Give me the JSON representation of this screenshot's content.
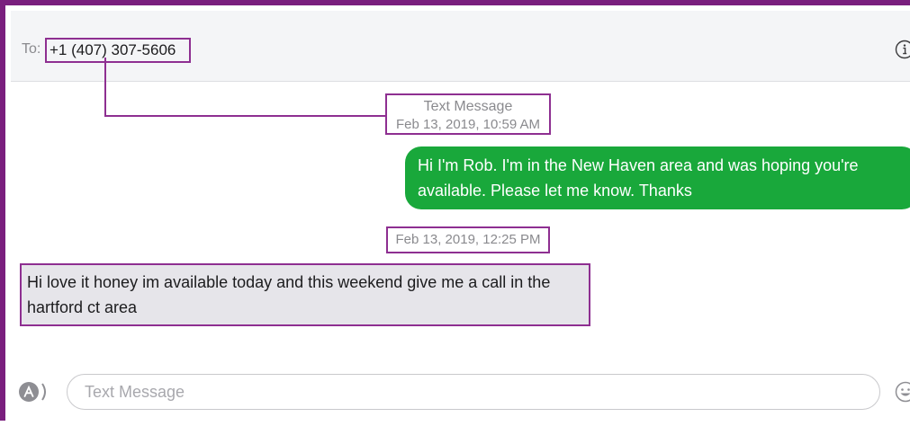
{
  "header": {
    "to_label": "To:",
    "recipient": "+1 (407) 307-5606",
    "info_icon": "info-circle-icon"
  },
  "conversation": {
    "first_timestamp": {
      "service": "Text Message",
      "time": "Feb 13, 2019, 10:59 AM"
    },
    "outgoing_message": "Hi I'm Rob. I'm in the New Haven area and was hoping you're available. Please let me know. Thanks",
    "second_timestamp": "Feb 13, 2019, 12:25 PM",
    "incoming_message": "Hi love it honey im available today and this weekend give me a call in the hartford ct area"
  },
  "composer": {
    "apps_icon": "app-store-icon",
    "placeholder": "Text Message",
    "value": "",
    "emoji_icon": "emoji-icon"
  },
  "colors": {
    "annotation_border": "#8e2f91",
    "frame_border": "#7a1f7e",
    "outgoing_bubble": "#19a83b",
    "incoming_bubble": "#e6e5ea",
    "header_bg": "#f4f5f7"
  }
}
